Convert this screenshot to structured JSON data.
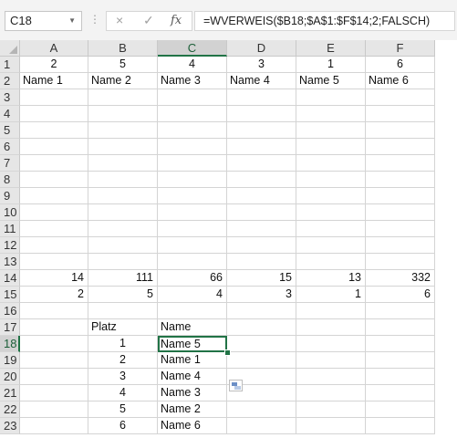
{
  "window": {
    "colors": {
      "accent": "#217346",
      "header": "#e6e6e6"
    }
  },
  "formula_bar": {
    "name_box": "C18",
    "cancel_icon": "×",
    "enter_icon": "✓",
    "fx_icon": "fx",
    "formula": "=WVERWEIS($B18;$A$1:$F$14;2;FALSCH)"
  },
  "columns": [
    "A",
    "B",
    "C",
    "D",
    "E",
    "F"
  ],
  "selected_column": "C",
  "rows": [
    1,
    2,
    3,
    4,
    5,
    6,
    7,
    8,
    9,
    10,
    11,
    12,
    13,
    14,
    15,
    16,
    17,
    18,
    19,
    20,
    21,
    22,
    23
  ],
  "selected_row": 18,
  "cells": {
    "A1": "2",
    "B1": "5",
    "C1": "4",
    "D1": "3",
    "E1": "1",
    "F1": "6",
    "A2": "Name 1",
    "B2": "Name 2",
    "C2": "Name 3",
    "D2": "Name 4",
    "E2": "Name 5",
    "F2": "Name 6",
    "A14": "14",
    "B14": "111",
    "C14": "66",
    "D14": "15",
    "E14": "13",
    "F14": "332",
    "A15": "2",
    "B15": "5",
    "C15": "4",
    "D15": "3",
    "E15": "1",
    "F15": "6",
    "B17": "Platz",
    "C17": "Name",
    "B18": "1",
    "C18": "Name 5",
    "B19": "2",
    "C19": "Name 1",
    "B20": "3",
    "C20": "Name 4",
    "B21": "4",
    "C21": "Name 3",
    "B22": "5",
    "C22": "Name 2",
    "B23": "6",
    "C23": "Name 6"
  },
  "active_cell": "C18"
}
